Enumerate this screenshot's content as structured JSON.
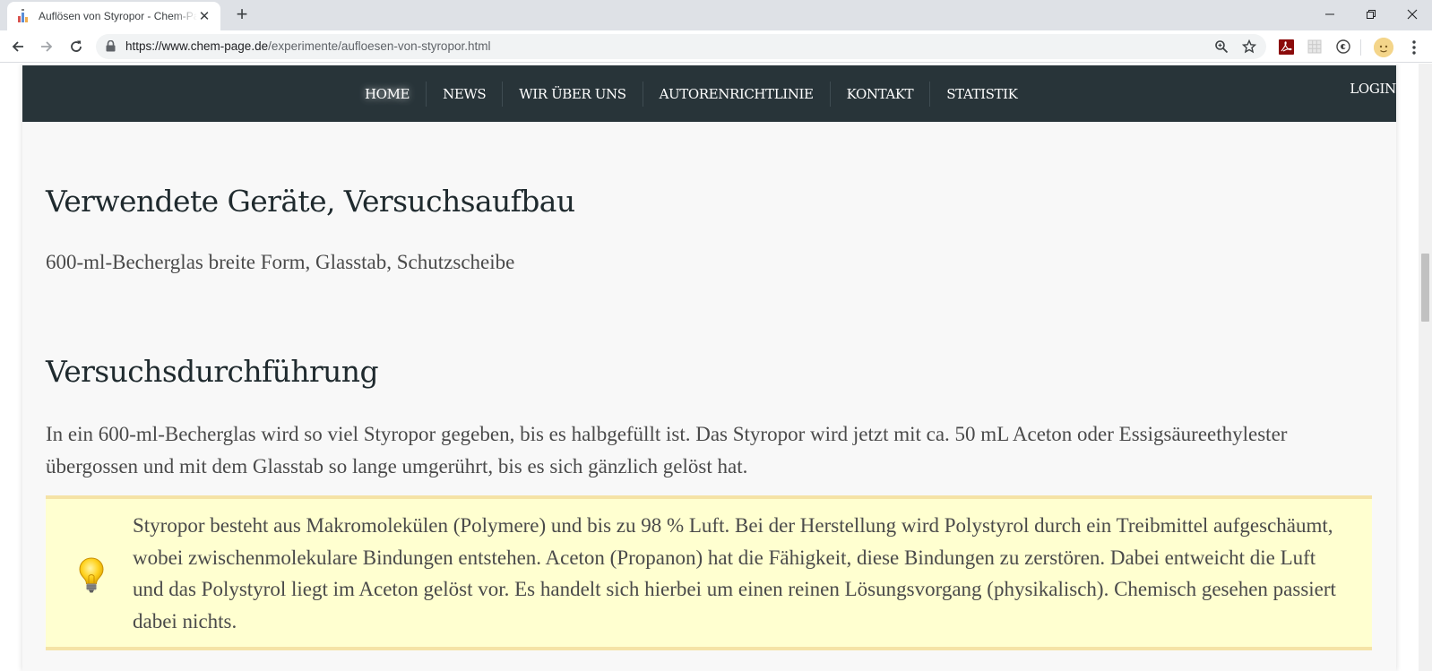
{
  "browser": {
    "tab_title": "Auflösen von Styropor - Chem-Page",
    "new_tab_symbol": "+",
    "url_host": "https://www.chem-page.de",
    "url_path": "/experimente/aufloesen-von-styropor.html",
    "icons": [
      "flask-favicon",
      "close-icon",
      "back-arrow-icon",
      "forward-arrow-icon",
      "reload-icon",
      "lock-icon",
      "zoom-icon",
      "star-icon",
      "pdf-extension-icon",
      "grid-extension-icon",
      "ghost-extension-icon",
      "profile-avatar",
      "menu-dots-icon"
    ]
  },
  "nav": {
    "items": [
      "HOME",
      "NEWS",
      "WIR ÜBER UNS",
      "AUTORENRICHTLINIE",
      "KONTAKT",
      "STATISTIK"
    ],
    "login": "LOGIN"
  },
  "content": {
    "heading_devices": "Verwendete Geräte, Versuchsaufbau",
    "devices_text": "600-ml-Becherglas breite Form, Glasstab, Schutzscheibe",
    "heading_procedure": "Versuchsdurchführung",
    "procedure_text": "In ein 600-ml-Becherglas wird so viel Styropor gegeben, bis es halbgefüllt ist. Das Styropor wird jetzt mit ca. 50 mL Aceton oder Essigsäureethylester übergossen und mit dem Glasstab so lange umgerührt, bis es sich gänzlich gelöst hat.",
    "info_text": "Styropor besteht aus Makromolekülen (Polymere) und bis zu 98 % Luft. Bei der Herstellung wird Polystyrol durch ein Treibmittel aufgeschäumt, wobei zwischenmolekulare Bindungen entstehen. Aceton (Propanon) hat die Fähigkeit, diese Bindungen zu zerstören. Dabei entweicht die Luft und das Polystyrol liegt im Aceton gelöst vor. Es handelt sich hierbei um einen reinen Lösungsvorgang (physikalisch). Chemisch gesehen passiert dabei nichts."
  },
  "colors": {
    "navbar_bg": "#283439",
    "page_bg": "#f8f8f8",
    "infobox_bg": "#ffffd0",
    "infobox_border": "#f5e3a6",
    "heading": "#1f2a2e",
    "body_text": "#4a4a4a"
  }
}
